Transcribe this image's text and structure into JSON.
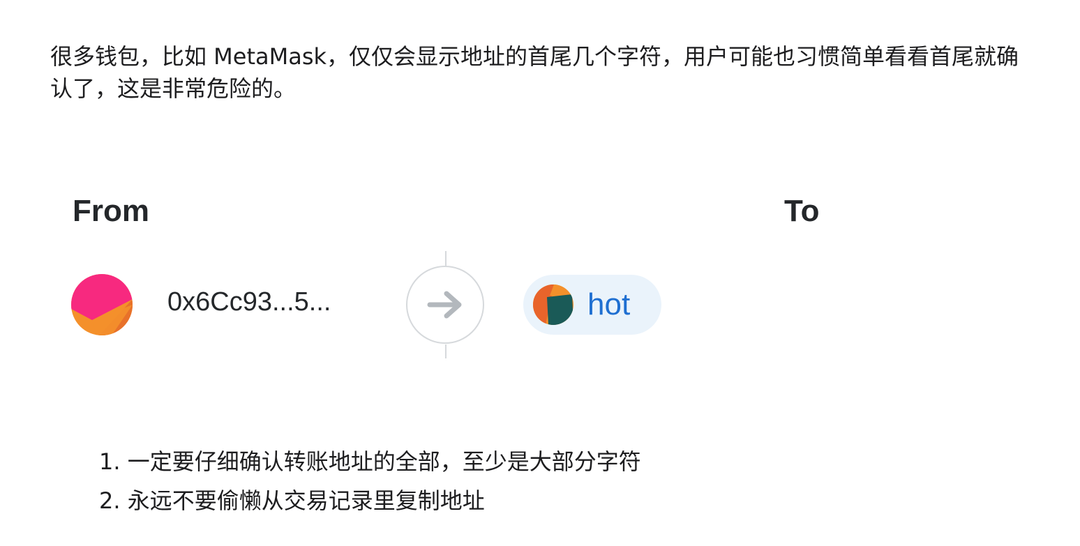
{
  "intro_text": "很多钱包，比如 MetaMask，仅仅会显示地址的首尾几个字符，用户可能也习惯简单看看首尾就确认了，这是非常危险的。",
  "transaction": {
    "from_label": "From",
    "to_label": "To",
    "from_address": "0x6Cc93...5...",
    "to_name": "hot"
  },
  "tips": [
    "1. 一定要仔细确认转账地址的全部，至少是大部分字符",
    "2. 永远不要偷懒从交易记录里复制地址"
  ],
  "icons": {
    "from_avatar": "jazzicon-avatar",
    "arrow": "arrow-right-icon",
    "to_avatar": "jazzicon-avatar"
  },
  "colors": {
    "recipient_text": "#1f6fd1",
    "recipient_pill_bg": "#eaf3fb",
    "divider": "#d6d9dc",
    "arrow": "#b3b8bd"
  }
}
